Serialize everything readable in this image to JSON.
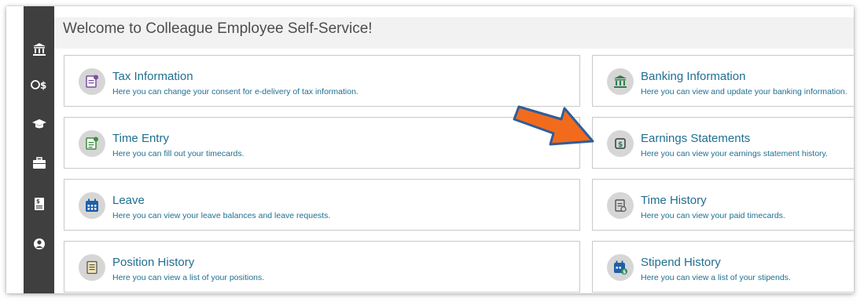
{
  "header": {
    "title": "Welcome to Colleague Employee Self-Service!"
  },
  "sidebar": {
    "items": [
      {
        "icon": "bank-icon"
      },
      {
        "icon": "money-exchange-icon"
      },
      {
        "icon": "graduation-cap-icon"
      },
      {
        "icon": "briefcase-icon"
      },
      {
        "icon": "pay-stub-icon"
      },
      {
        "icon": "user-icon"
      }
    ]
  },
  "tiles": [
    {
      "title": "Tax Information",
      "desc": "Here you can change your consent for e-delivery of tax information.",
      "icon": "tax-document-icon"
    },
    {
      "title": "Banking Information",
      "desc": "Here you can view and update your banking information.",
      "icon": "bank-icon"
    },
    {
      "title": "Time Entry",
      "desc": "Here you can fill out your timecards.",
      "icon": "timecard-icon"
    },
    {
      "title": "Earnings Statements",
      "desc": "Here you can view your earnings statement history.",
      "icon": "earnings-statement-icon"
    },
    {
      "title": "Leave",
      "desc": "Here you can view your leave balances and leave requests.",
      "icon": "calendar-icon"
    },
    {
      "title": "Time History",
      "desc": "Here you can view your paid timecards.",
      "icon": "time-history-icon"
    },
    {
      "title": "Position History",
      "desc": "Here you can view a list of your positions.",
      "icon": "position-list-icon"
    },
    {
      "title": "Stipend History",
      "desc": "Here you can view a list of your stipends.",
      "icon": "stipend-calendar-icon"
    }
  ],
  "annotation": {
    "arrow_color": "#f26b1d",
    "arrow_outline": "#2f5d9a",
    "icon": "pointer-arrow-icon"
  },
  "colors": {
    "link": "#1f6f90",
    "sidebar": "#3f3f3f",
    "header_bg": "#f2f2f2"
  }
}
